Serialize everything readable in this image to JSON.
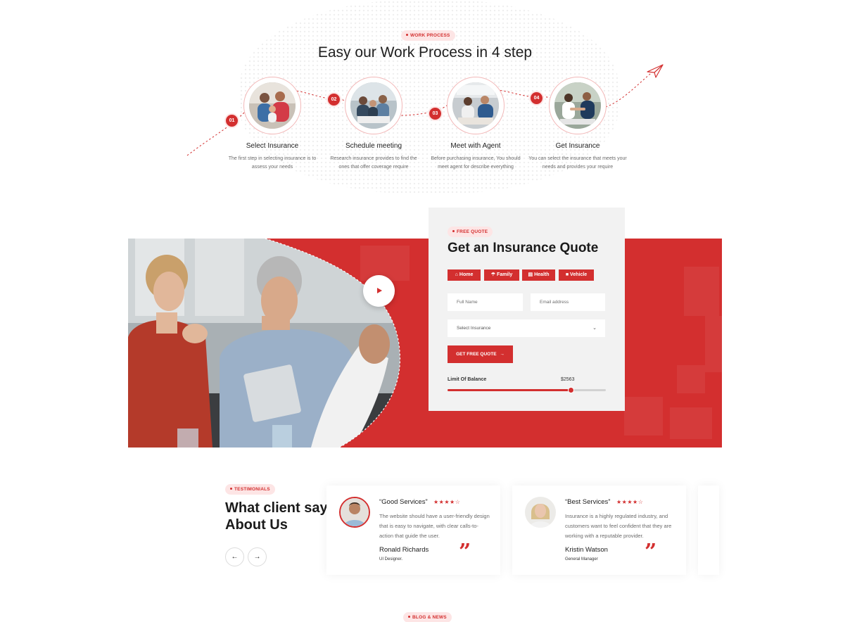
{
  "work_process": {
    "tag": "WORK PROCESS",
    "title": "Easy our Work Process in 4 step",
    "steps": [
      {
        "number": "01",
        "title": "Select Insurance",
        "description": "The first step in selecting insurance is to assess your needs"
      },
      {
        "number": "02",
        "title": "Schedule meeting",
        "description": "Research insurance provides to find the ones that offer coverage require"
      },
      {
        "number": "03",
        "title": "Meet with Agent",
        "description": "Before purchasing insurance, You should meet agent for describe everything"
      },
      {
        "number": "04",
        "title": "Get Insurance",
        "description": "You can select the insurance that meets your needs and provides your require"
      }
    ]
  },
  "quote": {
    "tag": "FREE QUOTE",
    "title": "Get an Insurance Quote",
    "tabs": [
      {
        "label": "Home",
        "icon": "home-icon"
      },
      {
        "label": "Family",
        "icon": "umbrella-icon"
      },
      {
        "label": "Health",
        "icon": "clipboard-icon"
      },
      {
        "label": "Vehicle",
        "icon": "car-icon"
      }
    ],
    "full_name_placeholder": "Full Name",
    "email_placeholder": "Email address",
    "select_placeholder": "Select Insurance",
    "button_label": "GET FREE QUOTE",
    "limit_label": "Limit Of Balance",
    "limit_value": "$2563",
    "limit_fraction": 0.78
  },
  "testimonials": {
    "tag": "TESTIMONIALS",
    "title_line1": "What client say",
    "title_line2": "About Us",
    "items": [
      {
        "heading": "“Good Services”",
        "stars": 4,
        "body": "The website should have a user-friendly design that is easy to navigate, with clear calls-to-action that guide the user.",
        "name": "Ronald Richards",
        "role": "UI Designer."
      },
      {
        "heading": "“Best Services”",
        "stars": 4,
        "body": "Insurance is a highly regulated industry, and customers want to feel confident that they are working with a reputable provider.",
        "name": "Kristin Watson",
        "role": "General Manager"
      }
    ]
  },
  "blog": {
    "tag": "BLOG & NEWS"
  },
  "colors": {
    "accent": "#d32f2f",
    "accent_light": "#fde5e5",
    "card_bg": "#f2f2f2"
  }
}
